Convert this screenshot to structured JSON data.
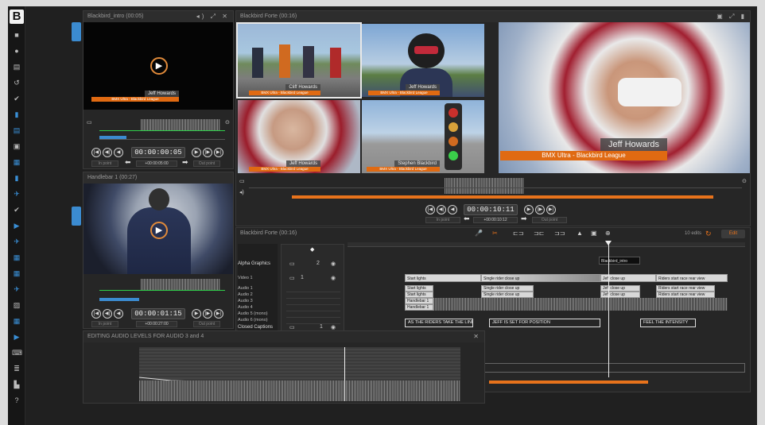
{
  "app": {
    "logo": "B"
  },
  "sidebar": {
    "icons": [
      "screen-icon",
      "gear-icon",
      "document-icon",
      "history-icon",
      "check-icon",
      "file-icon",
      "bmx-icon",
      "folder-icon",
      "calendar-icon",
      "page-icon",
      "twitter-icon",
      "check-icon",
      "youtube-icon",
      "twitter-icon",
      "calendar-icon",
      "calendar-icon",
      "twitter-icon",
      "image-icon",
      "calendar-icon",
      "youtube-icon",
      "keyboard-icon",
      "list-icon",
      "chart-icon",
      "help-icon"
    ],
    "icon_glyphs": [
      "■",
      "●",
      "▤",
      "↺",
      "✔",
      "▮",
      "▤",
      "▣",
      "▦",
      "▮",
      "✈",
      "✔",
      "▶",
      "✈",
      "▦",
      "▦",
      "✈",
      "▨",
      "▦",
      "▶",
      "⌨",
      "≣",
      "▙",
      "?"
    ]
  },
  "source_player": {
    "title": "Blackbird_intro (00:05)",
    "lower_third_name": "Jeff Howards",
    "lower_third_sub": "BMX Ultra - Blackbird League",
    "timecode": "00:00:00:05",
    "offset": "+00:00:05:00",
    "in_point": "In point",
    "out_point": "Out point"
  },
  "handlebar_player": {
    "title": "Handlebar 1 (00:27)",
    "timecode": "00:00:01:15",
    "offset": "+00:00:27:00",
    "in_point": "In point",
    "out_point": "Out point"
  },
  "multicam": {
    "title": "Blackbird Forte (00:16)",
    "tile_names": [
      "Cliff Howards",
      "Jeff Howards",
      "Jeff Howards",
      "Stephen Blackbird"
    ],
    "tile_sub": "BMX Ultra - Blackbird League"
  },
  "program_monitor": {
    "lower_third_name": "Jeff Howards",
    "lower_third_sub": "BMX Ultra - Blackbird League",
    "timecode": "00:00:10:11",
    "offset": "+00:00:10:12",
    "in_point": "In point",
    "out_point": "Out point"
  },
  "timeline": {
    "title": "Blackbird Forte (00:16)",
    "edits_label": "10 edits",
    "edit_button": "Edit",
    "track_labels": [
      "Alpha Graphics",
      "Video 1",
      "Audio 1",
      "Audio 2",
      "Audio 3",
      "Audio 4",
      "Audio 5 (mono)",
      "Audio 6 (mono)",
      "Closed Captions"
    ],
    "alpha_clip": "Blackbird_intro",
    "video_clips": [
      "Start lights",
      "Single rider close up",
      "Jeff close up",
      "Riders start race rear view"
    ],
    "audio_clips": [
      "Start lights",
      "Start lights",
      "Single rider close up",
      "Single rider close up",
      "Jeff close up",
      "Jeff close up",
      "Riders start race rear view",
      "Riders start race rear view",
      "Handlebar 1",
      "Handlebar 1"
    ],
    "captions": [
      "AS THE RIDERS TAKE THE LINE",
      "JEFF IS SET FOR POSITION",
      "FEEL THE INTENSITY"
    ],
    "track_numbers": [
      "2",
      "1",
      "1",
      "2",
      "3",
      "4",
      "5",
      "6",
      "1"
    ]
  },
  "audio_levels": {
    "title": "EDITING AUDIO LEVELS FOR AUDIO 3 and 4"
  },
  "colors": {
    "accent": "#e8731c",
    "brand_blue": "#3b8bd0",
    "background": "#202020"
  }
}
